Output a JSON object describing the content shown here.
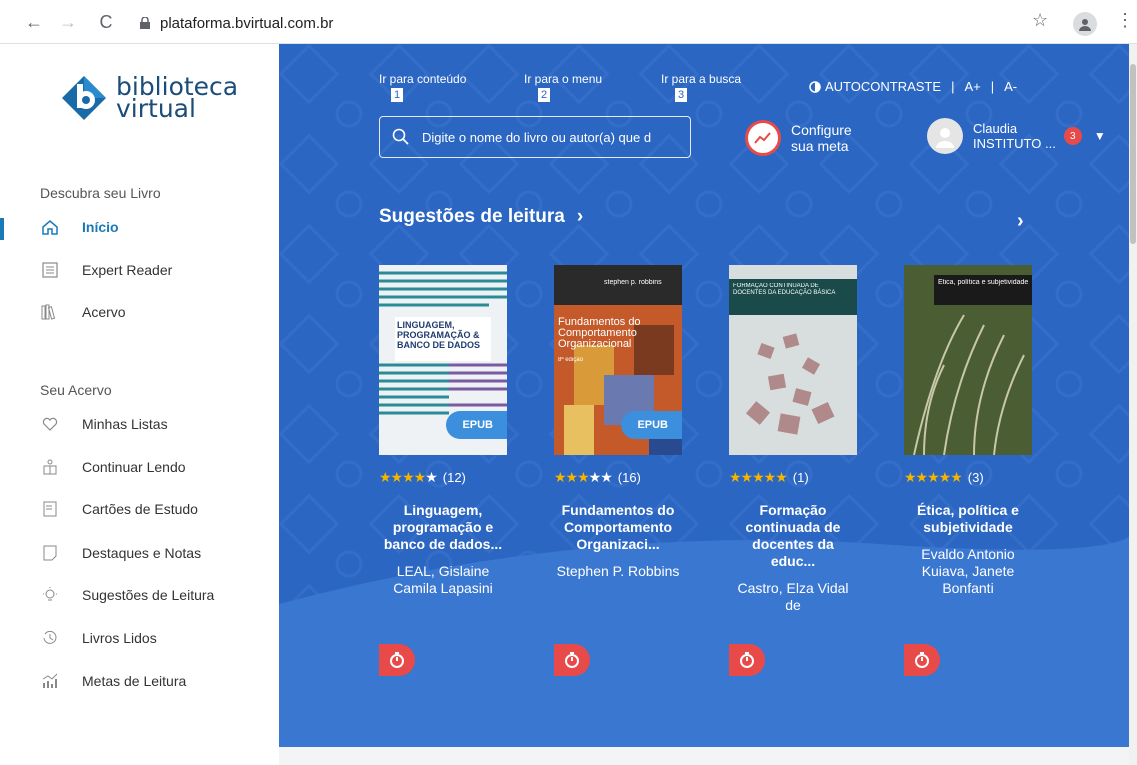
{
  "browser": {
    "url": "plataforma.bvirtual.com.br"
  },
  "logo": {
    "line1": "biblioteca",
    "line2": "virtual"
  },
  "sidebar": {
    "section1": "Descubra seu Livro",
    "section2": "Seu Acervo",
    "items": [
      {
        "label": "Início",
        "icon": "home-icon"
      },
      {
        "label": "Expert Reader",
        "icon": "list-icon"
      },
      {
        "label": "Acervo",
        "icon": "books-icon"
      },
      {
        "label": "Minhas Listas",
        "icon": "heart-icon"
      },
      {
        "label": "Continuar Lendo",
        "icon": "reading-icon"
      },
      {
        "label": "Cartões de Estudo",
        "icon": "cards-icon"
      },
      {
        "label": "Destaques e Notas",
        "icon": "note-icon"
      },
      {
        "label": "Sugestões de Leitura",
        "icon": "lightbulb-icon"
      },
      {
        "label": "Livros Lidos",
        "icon": "history-icon"
      },
      {
        "label": "Metas de Leitura",
        "icon": "chart-icon"
      }
    ]
  },
  "skip_links": [
    {
      "label": "Ir para conteúdo",
      "num": "1"
    },
    {
      "label": "Ir para o menu",
      "num": "2"
    },
    {
      "label": "Ir para a busca",
      "num": "3"
    }
  ],
  "accessibility": {
    "contrast": "AUTOCONTRASTE",
    "increase": "A+",
    "decrease": "A-"
  },
  "search": {
    "placeholder": "Digite o nome do livro ou autor(a) que d"
  },
  "goal": {
    "line1": "Configure",
    "line2": "sua meta"
  },
  "user": {
    "name": "Claudia",
    "org": "INSTITUTO ...",
    "notifications": "3"
  },
  "section": {
    "title": "Sugestões de leitura"
  },
  "books": [
    {
      "stars": 4,
      "rating_count": "(12)",
      "title": "Linguagem, programação e banco de dados...",
      "author": "LEAL, Gislaine Camila Lapasini",
      "epub": "EPUB"
    },
    {
      "stars": 3,
      "rating_count": "(16)",
      "title": "Fundamentos do Comportamento Organizaci...",
      "author": "Stephen P. Robbins",
      "epub": "EPUB"
    },
    {
      "stars": 5,
      "rating_count": "(1)",
      "title": "Formação continuada de docentes da educ...",
      "author": "Castro, Elza Vidal de"
    },
    {
      "stars": 5,
      "rating_count": "(3)",
      "title": "Ética, política e subjetividade",
      "author": "Evaldo Antonio Kuiava, Janete Bonfanti"
    }
  ],
  "covers": {
    "book1_text": "LINGUAGEM, PROGRAMAÇÃO & BANCO DE DADOS",
    "book2_author": "stephen p. robbins",
    "book2_title": "Fundamentos do Comportamento Organizacional",
    "book2_edition": "8ª edição",
    "book3_title": "FORMAÇÃO CONTINUADA DE DOCENTES DA EDUCAÇÃO BÁSICA",
    "book4_title": "Ética, política e subjetividade"
  },
  "colors": {
    "primary": "#2b66c2",
    "accent_red": "#e84a4a",
    "star": "#f5b400",
    "sidebar_active": "#1a7ab8"
  }
}
